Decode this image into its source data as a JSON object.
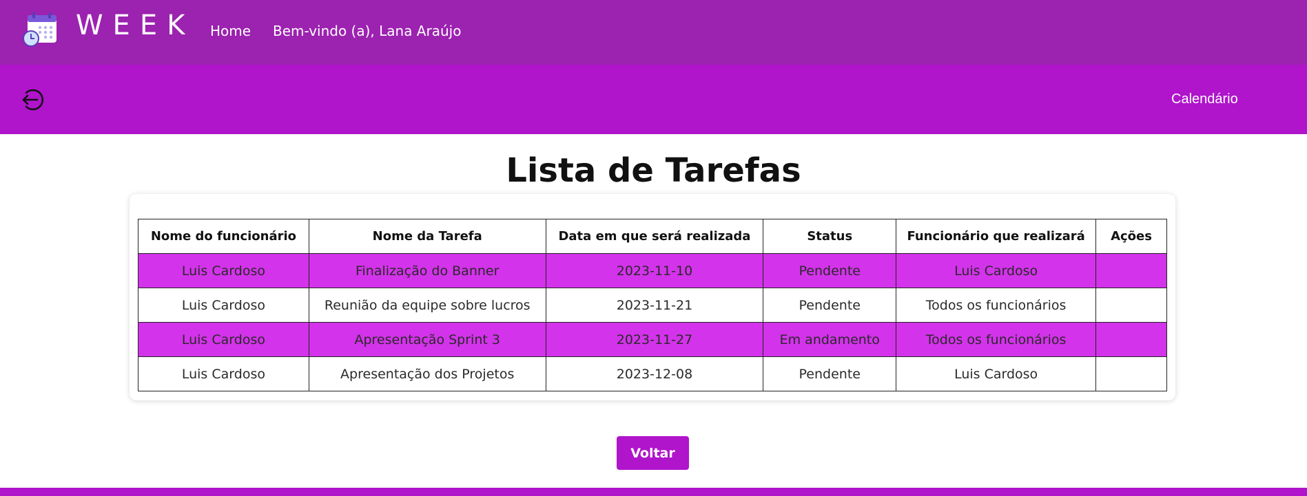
{
  "header": {
    "brand": "WEEK",
    "home_label": "Home",
    "welcome_text": "Bem-vindo (a), Lana Araújo",
    "logo_icon": "calendar-clock-icon",
    "color": "#9c22b0"
  },
  "subheader": {
    "logout_icon": "logout-arrow-icon",
    "calendar_label": "Calendário",
    "color": "#b014cb"
  },
  "main": {
    "title": "Lista de Tarefas",
    "table": {
      "columns": [
        "Nome do funcionário",
        "Nome da Tarefa",
        "Data em que será realizada",
        "Status",
        "Funcionário que realizará",
        "Ações"
      ],
      "rows": [
        [
          "Luis Cardoso",
          "Finalização do Banner",
          "2023-11-10",
          "Pendente",
          "Luis Cardoso",
          ""
        ],
        [
          "Luis Cardoso",
          "Reunião da equipe sobre lucros",
          "2023-11-21",
          "Pendente",
          "Todos os funcionários",
          ""
        ],
        [
          "Luis Cardoso",
          "Apresentação Sprint 3",
          "2023-11-27",
          "Em andamento",
          "Todos os funcionários",
          ""
        ],
        [
          "Luis Cardoso",
          "Apresentação dos Projetos",
          "2023-12-08",
          "Pendente",
          "Luis Cardoso",
          ""
        ]
      ],
      "highlight_color": "#d333ea"
    },
    "back_label": "Voltar"
  }
}
